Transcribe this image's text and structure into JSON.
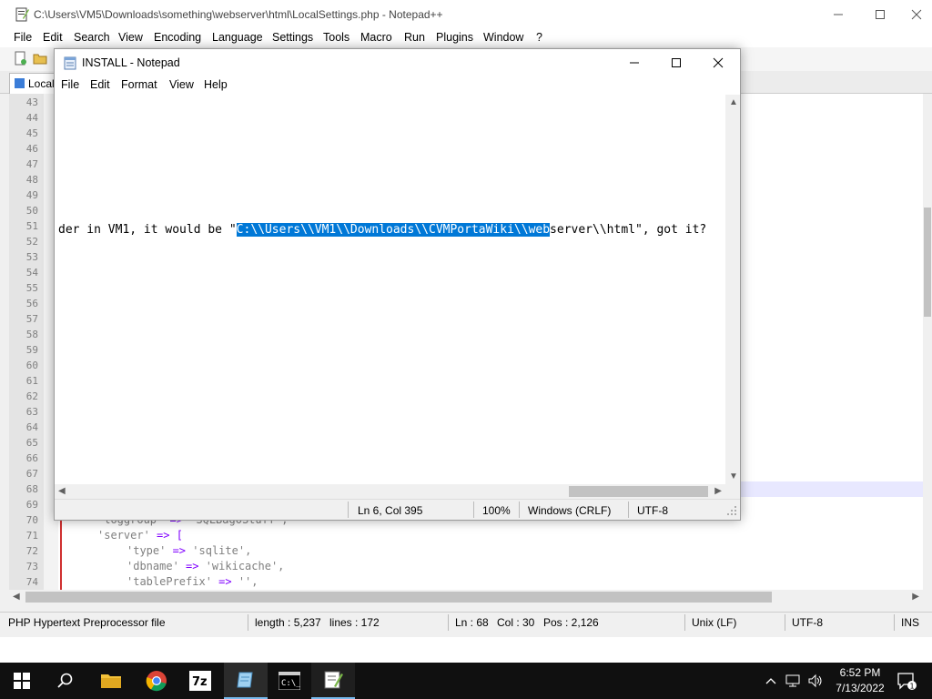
{
  "npp": {
    "title": "C:\\Users\\VM5\\Downloads\\something\\webserver\\html\\LocalSettings.php - Notepad++",
    "menu": [
      "File",
      "Edit",
      "Search",
      "View",
      "Encoding",
      "Language",
      "Settings",
      "Tools",
      "Macro",
      "Run",
      "Plugins",
      "Window",
      "?"
    ],
    "tab_label": "LocalS",
    "line_numbers": [
      "43",
      "44",
      "45",
      "46",
      "47",
      "48",
      "49",
      "50",
      "51",
      "52",
      "53",
      "54",
      "55",
      "56",
      "57",
      "58",
      "59",
      "60",
      "61",
      "62",
      "63",
      "64",
      "65",
      "66",
      "67",
      "68",
      "69",
      "70",
      "71",
      "72",
      "73",
      "74"
    ],
    "code_lines": [
      {
        "key": "'loggroup'",
        "op": " => ",
        "val": "'SQLBagOStuff',",
        "indent": ""
      },
      {
        "key": "'server'",
        "op": " => ",
        "val": "[",
        "indent": ""
      },
      {
        "key": "'type'",
        "op": " => ",
        "val": "'sqlite',",
        "indent": "    "
      },
      {
        "key": "'dbname'",
        "op": " => ",
        "val": "'wikicache',",
        "indent": "    "
      },
      {
        "key": "'tablePrefix'",
        "op": " => ",
        "val": "'',",
        "indent": "    "
      }
    ],
    "status": {
      "file_type": "PHP Hypertext Preprocessor file",
      "length": "length : 5,237",
      "lines": "lines : 172",
      "ln": "Ln : 68",
      "col": "Col : 30",
      "pos": "Pos : 2,126",
      "eol": "Unix (LF)",
      "encoding": "UTF-8",
      "mode": "INS"
    }
  },
  "notepad": {
    "title": "INSTALL - Notepad",
    "menu": [
      "File",
      "Edit",
      "Format",
      "View",
      "Help"
    ],
    "text_before": "der in VM1, it would be \"",
    "text_selected": "C:\\\\Users\\\\VM1\\\\Downloads\\\\CVMPortaWiki\\\\web",
    "text_after": "server\\\\html\", got it?",
    "status": {
      "position": "Ln 6, Col 395",
      "zoom": "100%",
      "eol": "Windows (CRLF)",
      "encoding": "UTF-8"
    }
  },
  "taskbar": {
    "time": "6:52 PM",
    "date": "7/13/2022",
    "notification_count": "1"
  },
  "colors": {
    "selection": "#0078d7",
    "php_string": "#808080",
    "php_operator": "#8000ff",
    "taskbar": "#101010"
  }
}
